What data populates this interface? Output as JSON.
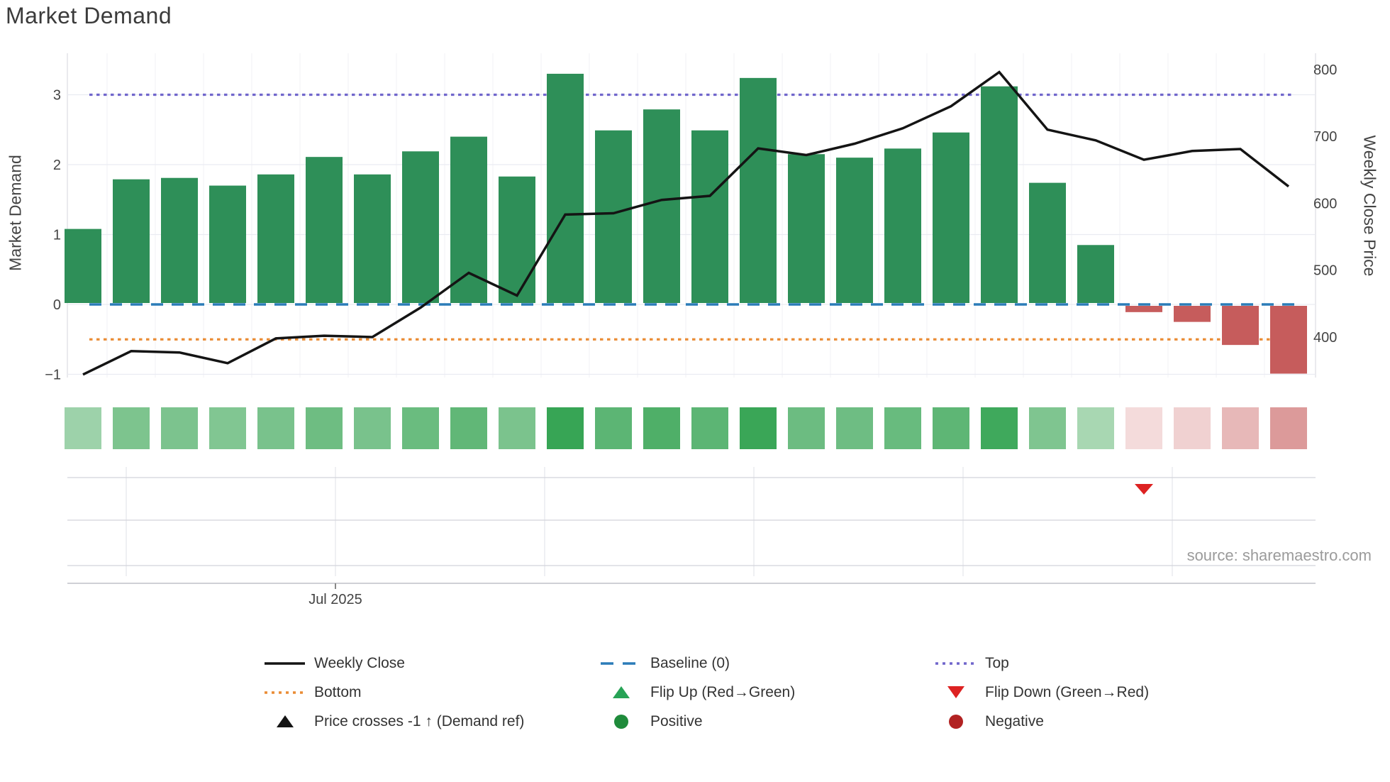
{
  "header": {
    "title": "Market Demand"
  },
  "footer": {
    "source": "source: sharemaestro.com"
  },
  "chart_data": {
    "type": "bar+line",
    "x_unit": "weekly",
    "n_points": 26,
    "x_axis": {
      "tick_label": "Jul 2025"
    },
    "left_axis": {
      "title": "Market Demand",
      "ticks": [
        3,
        2,
        1,
        0,
        -1
      ],
      "tick_labels": [
        "3",
        "2",
        "1",
        "0",
        "−1"
      ],
      "ylim": [
        -1.25,
        3.6
      ]
    },
    "right_axis": {
      "title": "Weekly Close Price",
      "ticks": [
        800,
        700,
        600,
        500,
        400
      ],
      "tick_labels": [
        "800",
        "700",
        "600",
        "500",
        "400"
      ],
      "ylim": [
        330,
        825
      ]
    },
    "bars": {
      "name": "Market Demand",
      "values": [
        1.08,
        1.79,
        1.81,
        1.7,
        1.86,
        2.11,
        1.86,
        2.19,
        2.4,
        1.83,
        3.3,
        2.49,
        2.79,
        2.49,
        3.24,
        2.15,
        2.1,
        2.23,
        2.46,
        3.12,
        1.74,
        0.85,
        -0.11,
        -0.25,
        -0.58,
        -0.99
      ]
    },
    "line": {
      "name": "Weekly Close",
      "axis": "right",
      "values": [
        344,
        379,
        377,
        361,
        398,
        402,
        400,
        444,
        496,
        462,
        583,
        585,
        605,
        611,
        682,
        672,
        689,
        712,
        745,
        796,
        710,
        694,
        665,
        678,
        681,
        625
      ]
    },
    "heatmap_source": "bars",
    "ref_lines": [
      {
        "name": "Top",
        "value": 3,
        "style": "dotted",
        "color_key": "top"
      },
      {
        "name": "Baseline (0)",
        "value": 0,
        "style": "dashed",
        "color_key": "baseline"
      },
      {
        "name": "Bottom",
        "value": -0.5,
        "style": "dotted",
        "color_key": "bottom"
      }
    ],
    "flip_down_marker_bar": 23,
    "legend_position": "bottom"
  },
  "legend": {
    "items": [
      {
        "id": "weekly-close",
        "label": "Weekly Close",
        "swatch": "line-solid",
        "color_key": "line"
      },
      {
        "id": "baseline",
        "label": "Baseline (0)",
        "swatch": "line-dashed",
        "color_key": "baseline"
      },
      {
        "id": "top",
        "label": "Top",
        "swatch": "line-dotted",
        "color_key": "top"
      },
      {
        "id": "bottom",
        "label": "Bottom",
        "swatch": "line-dotted",
        "color_key": "bottom"
      },
      {
        "id": "flip-up",
        "label": "Flip Up (Red→Green)",
        "swatch": "tri-up",
        "color_key": "flip_up"
      },
      {
        "id": "flip-down",
        "label": "Flip Down (Green→Red)",
        "swatch": "tri-down",
        "color_key": "flip_down"
      },
      {
        "id": "price-crosses",
        "label": "Price crosses -1 ↑ (Demand ref)",
        "swatch": "tri-up",
        "color_key": "line"
      },
      {
        "id": "positive",
        "label": "Positive",
        "swatch": "dot",
        "color_key": "positive_dot"
      },
      {
        "id": "negative",
        "label": "Negative",
        "swatch": "dot",
        "color_key": "negative_dot"
      }
    ]
  },
  "colors": {
    "bar_positive": "#2e8f58",
    "bar_negative": "#c65c5c",
    "line": "#141414",
    "baseline": "#2b7cb8",
    "bottom": "#ea8c35",
    "top": "#7066cc",
    "flip_up": "#27a356",
    "flip_down": "#dd2222",
    "positive_dot": "#1f8b3b",
    "negative_dot": "#b22222",
    "heat_pos_lo": "#cfe8d3",
    "heat_pos_hi": "#2ea14d",
    "heat_neg_lo": "#f7e3e3",
    "heat_neg_hi": "#c05050",
    "grid": "#eaecf2",
    "grid_vertical": "#f0f1f6",
    "sub_grid": "#d2d4da",
    "sub_vgrid": "#e4e5eb",
    "spine": "#cfd0d6",
    "tick_text": "#444444"
  }
}
